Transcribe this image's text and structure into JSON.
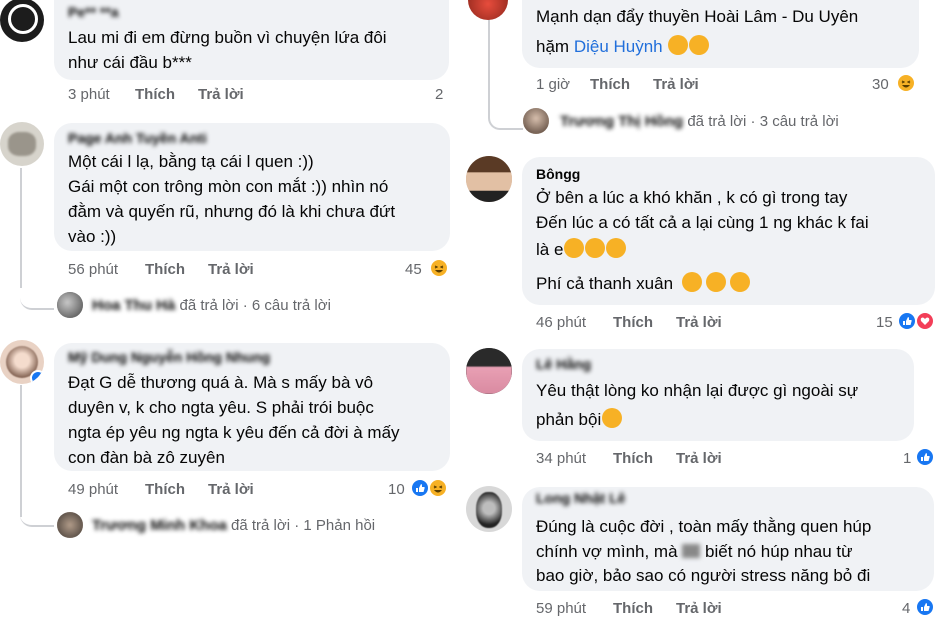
{
  "left": [
    {
      "author": "Pe** **a",
      "lines": [
        "Lau mi đi em đừng buồn vì chuyện lứa đôi",
        "như cái đầu b***"
      ],
      "time": "3 phút",
      "like": "Thích",
      "reply": "Trả lời",
      "count": "2"
    },
    {
      "author": "Page Anh Tuyền Anti",
      "lines": [
        "Một cái l lạ, bằng tạ cái l quen :))",
        "Gái một con trông mòn con mắt :)) nhìn nó",
        "đằm và quyến rũ, nhưng đó là khi chưa đứt",
        "vào :))"
      ],
      "time": "56 phút",
      "like": "Thích",
      "reply": "Trả lời",
      "count": "45",
      "replies_by": "Hoa Thu Hà",
      "replies_text": "đã trả lời · 6 câu trả lời"
    },
    {
      "author": "Mỹ Dung Nguyễn Hồng Nhung",
      "lines": [
        "Đạt G dễ thương quá à. Mà s mấy bà vô",
        "duyên v, k cho ngta yêu. S phải trói buộc",
        "ngta ép yêu ng ngta k yêu đến cả đời à mấy",
        "con đàn bà zô zuyên"
      ],
      "time": "49 phút",
      "like": "Thích",
      "reply": "Trả lời",
      "count": "10",
      "replies_by": "Trương Minh Khoa",
      "replies_text": "đã trả lời · 1 Phản hồi"
    }
  ],
  "right": [
    {
      "lines": [
        "Mạnh dạn đẩy thuyền Hoài Lâm - Du Uyên",
        "hặm"
      ],
      "mention": "Diệu Huỳnh",
      "time": "1 giờ",
      "like": "Thích",
      "reply": "Trả lời",
      "count": "30",
      "replies_by": "Trương Thị Hồng",
      "replies_text": "đã trả lời · 3 câu trả lời"
    },
    {
      "author": "Bôngg",
      "lines": [
        "Ở bên a lúc a khó khăn , k có gì trong tay",
        "Đến lúc  a có tất cả a lại cùng 1 ng khác k fai",
        "là e"
      ],
      "line4": "Phí cả thanh xuân",
      "time": "46 phút",
      "like": "Thích",
      "reply": "Trả lời",
      "count": "15"
    },
    {
      "author": "Lê Hằng",
      "lines": [
        "Yêu thật lòng ko nhận lại được gì ngoài sự",
        "phản bội"
      ],
      "time": "34 phút",
      "like": "Thích",
      "reply": "Trả lời",
      "count": "1"
    },
    {
      "author": "Long Nhật Lê",
      "lines": [
        "Đúng là cuộc đời , toàn mấy thằng quen húp",
        "chính vợ mình, mà",
        "biết nó húp nhau từ",
        "bao giờ, bảo sao có người stress năng bỏ đi"
      ],
      "time": "59 phút",
      "like": "Thích",
      "reply": "Trả lời",
      "count": "4"
    }
  ],
  "colors": {
    "bubble": "#f0f2f5",
    "meta": "#65676b",
    "like": "#1877f2",
    "love": "#f33e58",
    "haha": "#f7b125",
    "mention": "#216fdb"
  }
}
